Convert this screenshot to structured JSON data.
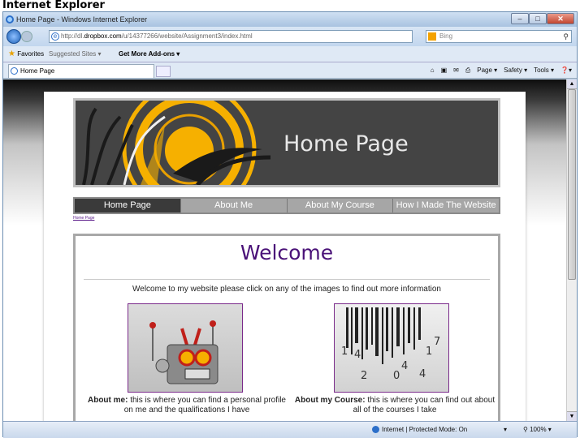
{
  "caption": "Internet Explorer",
  "window": {
    "title": "Home Page - Windows Internet Explorer",
    "minimize": "–",
    "maximize": "□",
    "close": "✕"
  },
  "address": {
    "url_prefix": "http://dl.",
    "url_domain": "dropbox.com",
    "url_rest": "/u/14377266/website/Assignment3/index.html",
    "search_placeholder": "Bing",
    "search_icon": "magnifier-icon"
  },
  "favbar": {
    "favorites": "Favorites",
    "suggested": "Suggested Sites ▾",
    "get_more": "Get More Add-ons ▾"
  },
  "tab": {
    "title": "Home Page"
  },
  "commands": {
    "page": "Page ▾",
    "safety": "Safety ▾",
    "tools": "Tools ▾",
    "help": "❓▾"
  },
  "site": {
    "banner_title": "Home Page",
    "menu": [
      "Home Page",
      "About Me",
      "About My Course",
      "How I Made The Website"
    ],
    "active_menu_index": 0,
    "breadcrumb": "Home Page",
    "welcome": "Welcome",
    "intro": "Welcome to my website please click on any of the images to find out more information",
    "card1": {
      "bold": "About me:",
      "text": " this is where you can find a personal profile on me and the qualifications I have"
    },
    "card2": {
      "bold": "About my Course:",
      "text": " this is where you can find out about all of the courses I take"
    },
    "barcode_digits": [
      "1",
      "4",
      "2",
      "0",
      "4",
      "4",
      "1",
      "7"
    ]
  },
  "status": {
    "mode": "Internet | Protected Mode: On",
    "security": "▾",
    "zoom": "100% ▾"
  },
  "colors": {
    "welcome": "#4a1278",
    "banner_bg": "#444444",
    "sun": "#f6b000"
  }
}
